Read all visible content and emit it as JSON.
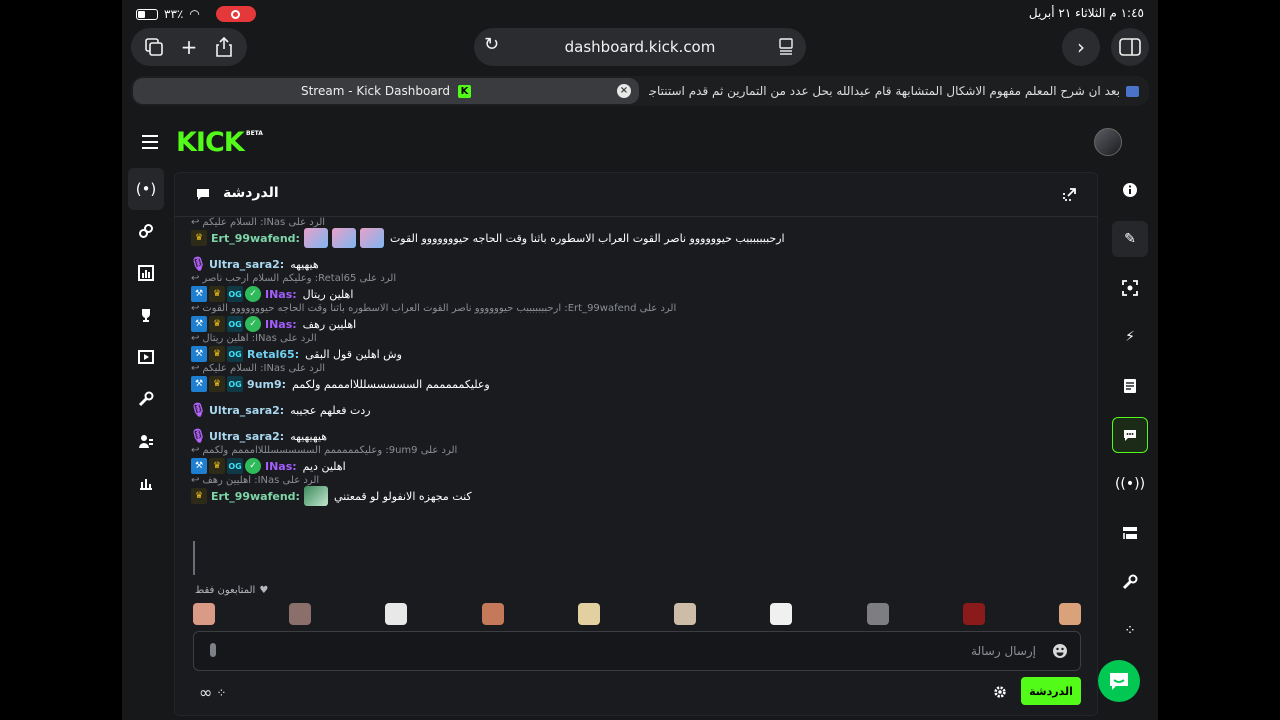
{
  "status_bar": {
    "time_date": "١:٤٥ م   الثلاثاء ٢١ أبريل",
    "battery": "٣٣٪"
  },
  "browser": {
    "url": "dashboard.kick.com",
    "tabs": [
      {
        "label": "Stream - Kick Dashboard",
        "active": true
      },
      {
        "label": "بعد ان شرح المعلم مفهوم الاشكال المتشابهة قام عبدالله بحل عدد من التمارين ثم قدم استنتاجا...",
        "active": false
      }
    ]
  },
  "kick": {
    "logo": "KICK",
    "beta": "BETA"
  },
  "chat": {
    "title": "الدردشة",
    "messages": [
      {
        "reply_to": "الرد على INas: السلام عليكم",
        "username": "Ert_99wafend:",
        "badges": [
          "crown"
        ],
        "color": "u-green",
        "text": "ارحبببببببب حيوووووو ناصر القوت العراب الاسطوره باثنا وقت الحاجه حيووووووو القوت",
        "emotes": 3
      },
      {
        "reply_to": "",
        "username": "Ultra_sara2:",
        "badges": [
          "mic"
        ],
        "color": "u-light",
        "text": "هيهيهه",
        "emotes": 0
      },
      {
        "reply_to": "الرد على Retal65: وعليكم السلام ارحب ناصر",
        "username": "INas:",
        "badges": [
          "mod",
          "crown",
          "og",
          "verified"
        ],
        "color": "u-purple",
        "text": "اهلين ريتال",
        "emotes": 0
      },
      {
        "reply_to": "الرد على Ert_99wafend: ارحبببببببب حيوووووو ناصر القوت العراب الاسطوره باثنا وقت الحاجه حيووووووو القوت",
        "username": "INas:",
        "badges": [
          "mod",
          "crown",
          "og",
          "verified"
        ],
        "color": "u-purple",
        "text": "اهليين رهف",
        "emotes": 0
      },
      {
        "reply_to": "الرد على INas: اهلين ريتال",
        "username": "Retal65:",
        "badges": [
          "mod",
          "crown",
          "og"
        ],
        "color": "u-blue",
        "text": "وش اهلين قول البقى",
        "emotes": 0
      },
      {
        "reply_to": "الرد على INas: السلام عليكم",
        "username": "9um9:",
        "badges": [
          "mod",
          "crown",
          "og"
        ],
        "color": "u-light",
        "text": "وعليكمممممم السسسسسلللاامممم ولكمم",
        "emotes": 0
      },
      {
        "reply_to": "",
        "username": "Ultra_sara2:",
        "badges": [
          "mic"
        ],
        "color": "u-light",
        "text": "ردت فعلهم عجيبه",
        "emotes": 0
      },
      {
        "reply_to": "",
        "username": "Ultra_sara2:",
        "badges": [
          "mic"
        ],
        "color": "u-light",
        "text": "هيهيهيهه",
        "emotes": 0
      },
      {
        "reply_to": "الرد على 9um9: وعليكمممممم السسسسسلللاامممم ولكمم",
        "username": "INas:",
        "badges": [
          "mod",
          "crown",
          "og",
          "verified"
        ],
        "color": "u-purple",
        "text": "اهلين ديم",
        "emotes": 0
      },
      {
        "reply_to": "الرد على INas: اهليين رهف",
        "username": "Ert_99wafend:",
        "badges": [
          "crown"
        ],
        "color": "u-green",
        "text": "كنت مجهزه الانفولو لو قمعتني",
        "emotes": 1
      }
    ],
    "followers_only": "المتابعون فقط",
    "input_placeholder": "إرسال رسالة",
    "send_label": "الدردشة",
    "emote_colors": [
      "#d99a86",
      "#8a6f6a",
      "#e8e8e8",
      "#c47a5a",
      "#e3d0a0",
      "#cdbca8",
      "#f0f0f0",
      "#7d7d82",
      "#8b1b1b",
      "#d9a27a"
    ]
  }
}
